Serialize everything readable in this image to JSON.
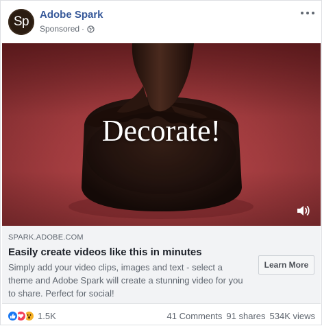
{
  "post": {
    "avatar_text": "Sp",
    "page_name": "Adobe Spark",
    "sponsored_label": "Sponsored",
    "separator": "·"
  },
  "video": {
    "overlay_text": "Decorate!"
  },
  "link": {
    "domain": "SPARK.ADOBE.COM",
    "title": "Easily create videos like this in minutes",
    "description": "Simply add your video clips, images and text - select a theme and Adobe Spark will create a stunning video for you to share. Perfect for social!",
    "cta_label": "Learn More"
  },
  "engagement": {
    "reaction_count": "1.5K",
    "comments": "41 Comments",
    "shares": "91 shares",
    "views": "534K views"
  },
  "colors": {
    "page_name": "#365899",
    "plate_red": "#a23c3f",
    "chocolate": "#2a1610",
    "like_blue": "#1877f2",
    "love_red": "#f33e58",
    "wow_yellow": "#f7b125"
  },
  "icons": {
    "options": "more-horizontal-icon",
    "audience": "globe-icon",
    "sound": "volume-icon",
    "reactions": [
      "like-icon",
      "love-icon",
      "wow-icon"
    ]
  }
}
